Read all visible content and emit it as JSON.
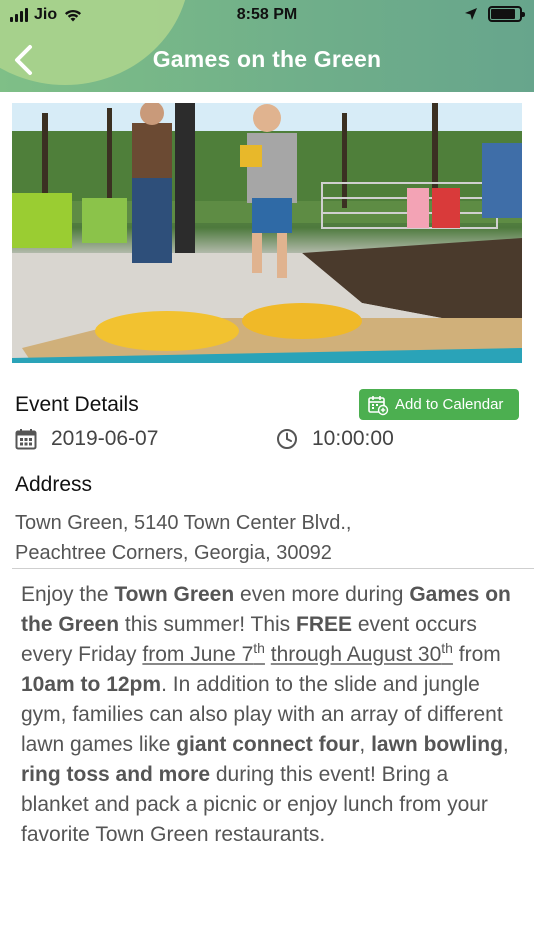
{
  "status_bar": {
    "carrier": "Jio",
    "time": "8:58 PM"
  },
  "nav": {
    "title": "Games on the Green"
  },
  "event": {
    "section_title": "Event Details",
    "add_to_calendar": "Add to Calendar",
    "date": "2019-06-07",
    "time": "10:00:00"
  },
  "address": {
    "title": "Address",
    "line1": "Town Green, 5140 Town Center Blvd.,",
    "line2": "Peachtree Corners, Georgia, 30092"
  },
  "description": {
    "p1": "Enjoy the ",
    "b1": "Town Green",
    "p2": " even more during ",
    "b2": "Games on the Green",
    "p3": " this summer! This ",
    "b3": "FREE",
    "p4": " event occurs every Friday ",
    "u1": "from June 7",
    "u1_sup": "th",
    "u2": "through August 30",
    "u2_sup": "th",
    "p5": " from ",
    "b4": "10am to 12pm",
    "p6": ". In addition to the slide and jungle gym, families can also play with an array of different lawn games like ",
    "b5": "giant connect four",
    "p7": ", ",
    "b6": "lawn bowling",
    "p8": ", ",
    "b7": "ring toss and more",
    "p9": " during this event!  Bring a blanket and pack a picnic or enjoy lunch from your favorite Town Green restaurants."
  },
  "colors": {
    "header_green": "#6fae8a",
    "button_green": "#4caf50"
  },
  "icons": [
    "back-chevron-icon",
    "calendar-add-icon",
    "calendar-icon",
    "clock-icon",
    "wifi-icon",
    "location-arrow-icon",
    "battery-icon"
  ]
}
